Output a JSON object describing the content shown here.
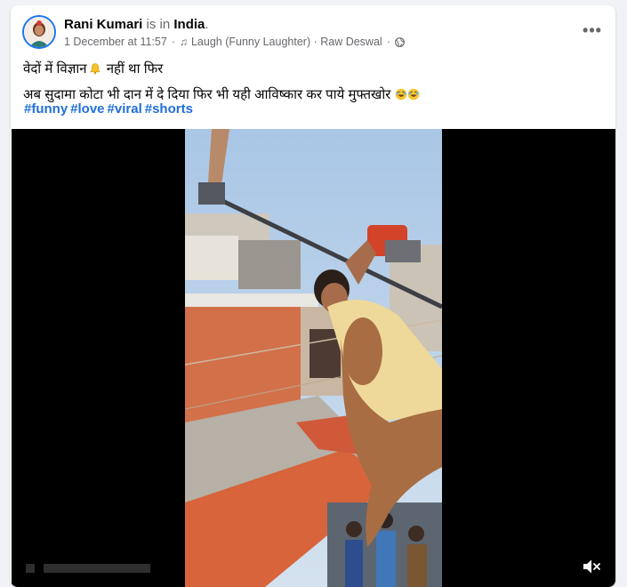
{
  "post": {
    "author": {
      "name": "Rani Kumari",
      "status_text": " is in ",
      "location": "India",
      "location_suffix": "."
    },
    "meta": {
      "date": "1 December at 11:57",
      "dot": "·",
      "audio_icon": "music-note-icon",
      "audio": "Laugh (Funny Laughter) · Raw Deswal",
      "privacy_icon": "globe-icon"
    },
    "more_icon": "more-options-icon",
    "text": {
      "line1_part1": "वेदों में विज्ञान",
      "line1_emoji": "bell-emoji",
      "line1_part2": " नहीं था फिर",
      "line2": "अब सुदामा कोटा भी  दान में दे दिया फिर भी यही आविष्कार कर पाये मुफ्तखोर",
      "line2_emoji": "rolling-laughing-emoji"
    },
    "hashtags": [
      "#funny",
      "#love",
      "#viral",
      "#shorts"
    ],
    "video": {
      "mute_icon": "muted-speaker-icon"
    }
  }
}
